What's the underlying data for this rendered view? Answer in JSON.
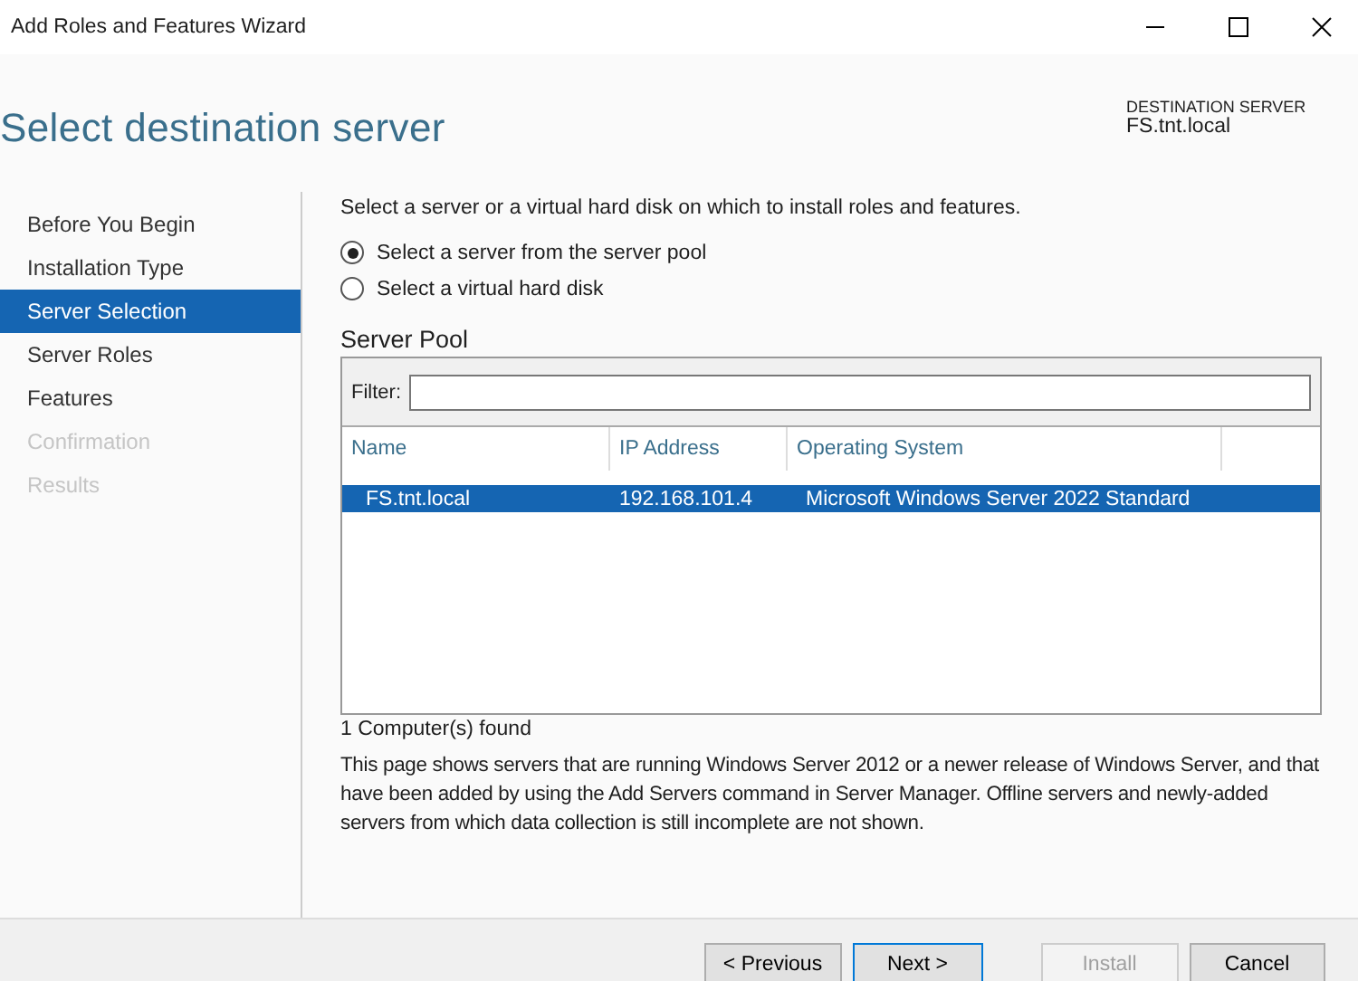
{
  "window": {
    "title": "Add Roles and Features Wizard"
  },
  "header": {
    "title": "Select destination server",
    "destination_label": "DESTINATION SERVER",
    "destination_value": "FS.tnt.local"
  },
  "sidebar": {
    "items": [
      {
        "label": "Before You Begin",
        "selected": false,
        "disabled": false
      },
      {
        "label": "Installation Type",
        "selected": false,
        "disabled": false
      },
      {
        "label": "Server Selection",
        "selected": true,
        "disabled": false
      },
      {
        "label": "Server Roles",
        "selected": false,
        "disabled": false
      },
      {
        "label": "Features",
        "selected": false,
        "disabled": false
      },
      {
        "label": "Confirmation",
        "selected": false,
        "disabled": true
      },
      {
        "label": "Results",
        "selected": false,
        "disabled": true
      }
    ]
  },
  "intro": "Select a server or a virtual hard disk on which to install roles and features.",
  "options": [
    {
      "label": "Select a server from the server pool",
      "selected": true
    },
    {
      "label": "Select a virtual hard disk",
      "selected": false
    }
  ],
  "pool": {
    "title": "Server Pool",
    "filter_label": "Filter:",
    "columns": [
      "Name",
      "IP Address",
      "Operating System"
    ],
    "rows": [
      {
        "cells": [
          "FS.tnt.local",
          "192.168.101.4",
          "Microsoft Windows Server 2022 Standard"
        ],
        "selected": true
      }
    ]
  },
  "count": "1 Computer(s) found",
  "note": "This page shows servers that are running Windows Server 2012 or a newer release of Windows Server, and that have been added by using the Add Servers command in Server Manager. Offline servers and newly-added servers from which data collection is still incomplete are not shown.",
  "buttons": [
    {
      "label": "< Previous",
      "disabled": false,
      "default": false
    },
    {
      "label": "Next >",
      "disabled": false,
      "default": true
    },
    {
      "label": "Install",
      "disabled": true,
      "default": false
    },
    {
      "label": "Cancel",
      "disabled": false,
      "default": false
    }
  ]
}
